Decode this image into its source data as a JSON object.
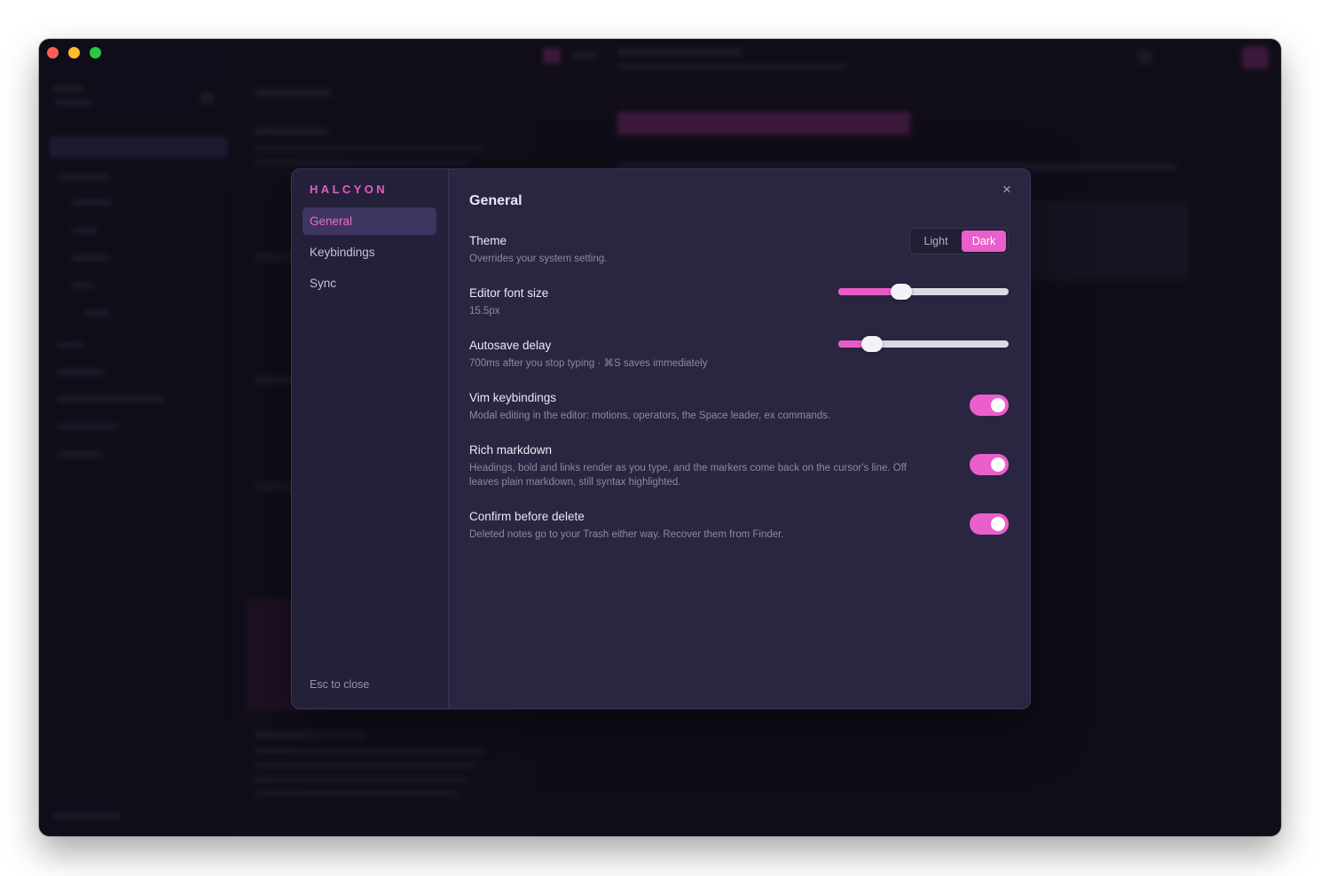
{
  "app": {
    "brand": "HALCYON"
  },
  "settings_nav": {
    "items": [
      {
        "label": "General",
        "active": true
      },
      {
        "label": "Keybindings",
        "active": false
      },
      {
        "label": "Sync",
        "active": false
      }
    ],
    "hint": "Esc to close"
  },
  "panel": {
    "title": "General",
    "close_icon": "×",
    "theme": {
      "label": "Theme",
      "desc": "Overrides your system setting.",
      "options": [
        "Light",
        "Dark"
      ],
      "selected": "Dark"
    },
    "font_size": {
      "label": "Editor font size",
      "desc": "15.5px",
      "level": 0.37
    },
    "autosave": {
      "label": "Autosave delay",
      "desc": "700ms after you stop typing · ⌘S saves immediately",
      "level": 0.2
    },
    "vim": {
      "label": "Vim keybindings",
      "desc": "Modal editing in the editor: motions, operators, the Space leader, ex commands.",
      "on": true
    },
    "rich_markdown": {
      "label": "Rich markdown",
      "desc": "Headings, bold and links render as you type, and the markers come back on the cursor's line. Off leaves plain markdown, still syntax highlighted.",
      "on": true
    },
    "confirm_delete": {
      "label": "Confirm before delete",
      "desc": "Deleted notes go to your Trash either way. Recover them from Finder.",
      "on": true
    }
  },
  "colors": {
    "accent": "#ea5fcb",
    "brand": "#e35cc5",
    "dialog_bg": "#2a2540",
    "window_bg": "#16131f"
  }
}
